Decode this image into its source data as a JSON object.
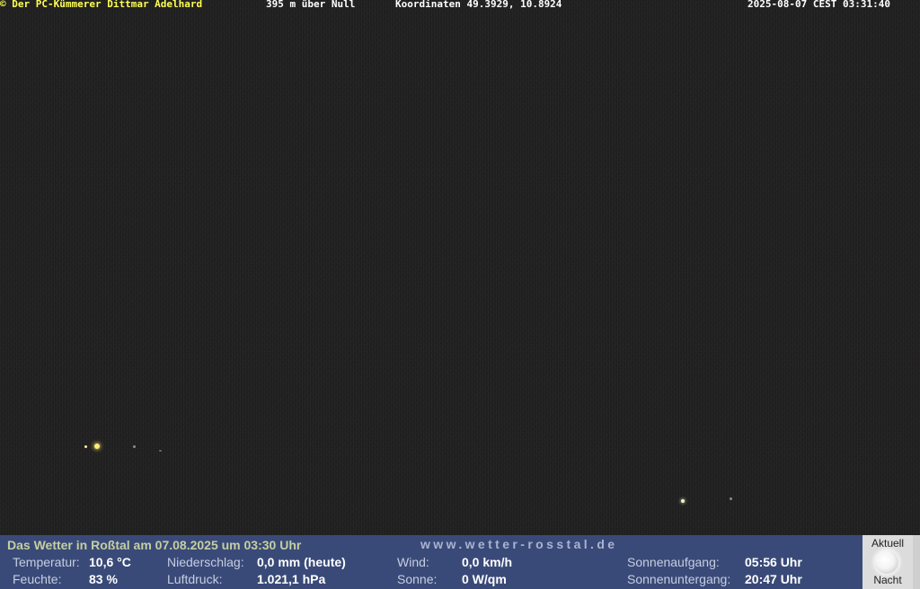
{
  "overlay": {
    "owner": "© Der PC-Kümmerer Dittmar Adelhard",
    "altitude": "395 m über Null",
    "coordinates": "Koordinaten 49.3929, 10.8924",
    "timestamp": "2025-08-07 CEST 03:31:40"
  },
  "weather": {
    "title": "Das Wetter in Roßtal am 07.08.2025 um 03:30 Uhr",
    "website": "www.wetter-rosstal.de",
    "temperature": {
      "label": "Temperatur:",
      "value": "10,6 °C"
    },
    "humidity": {
      "label": "Feuchte:",
      "value": "83 %"
    },
    "precipitation": {
      "label": "Niederschlag:",
      "value": "0,0 mm (heute)"
    },
    "pressure": {
      "label": "Luftdruck:",
      "value": "1.021,1 hPa"
    },
    "wind": {
      "label": "Wind:",
      "value": "0,0 km/h"
    },
    "sun_radiation": {
      "label": "Sonne:",
      "value": "0 W/qm"
    },
    "sunrise": {
      "label": "Sonnenaufgang:",
      "value": "05:56 Uhr"
    },
    "sunset": {
      "label": "Sonnenuntergang:",
      "value": "20:47 Uhr"
    }
  },
  "moon": {
    "top_label": "Aktuell",
    "bottom_label": "Nacht",
    "icon": "full-moon-icon"
  },
  "colors": {
    "owner_text": "#ffff55",
    "overlay_text": "#ffffff",
    "panel_background": "#3a4a78",
    "title_text": "#c5cfa0"
  }
}
